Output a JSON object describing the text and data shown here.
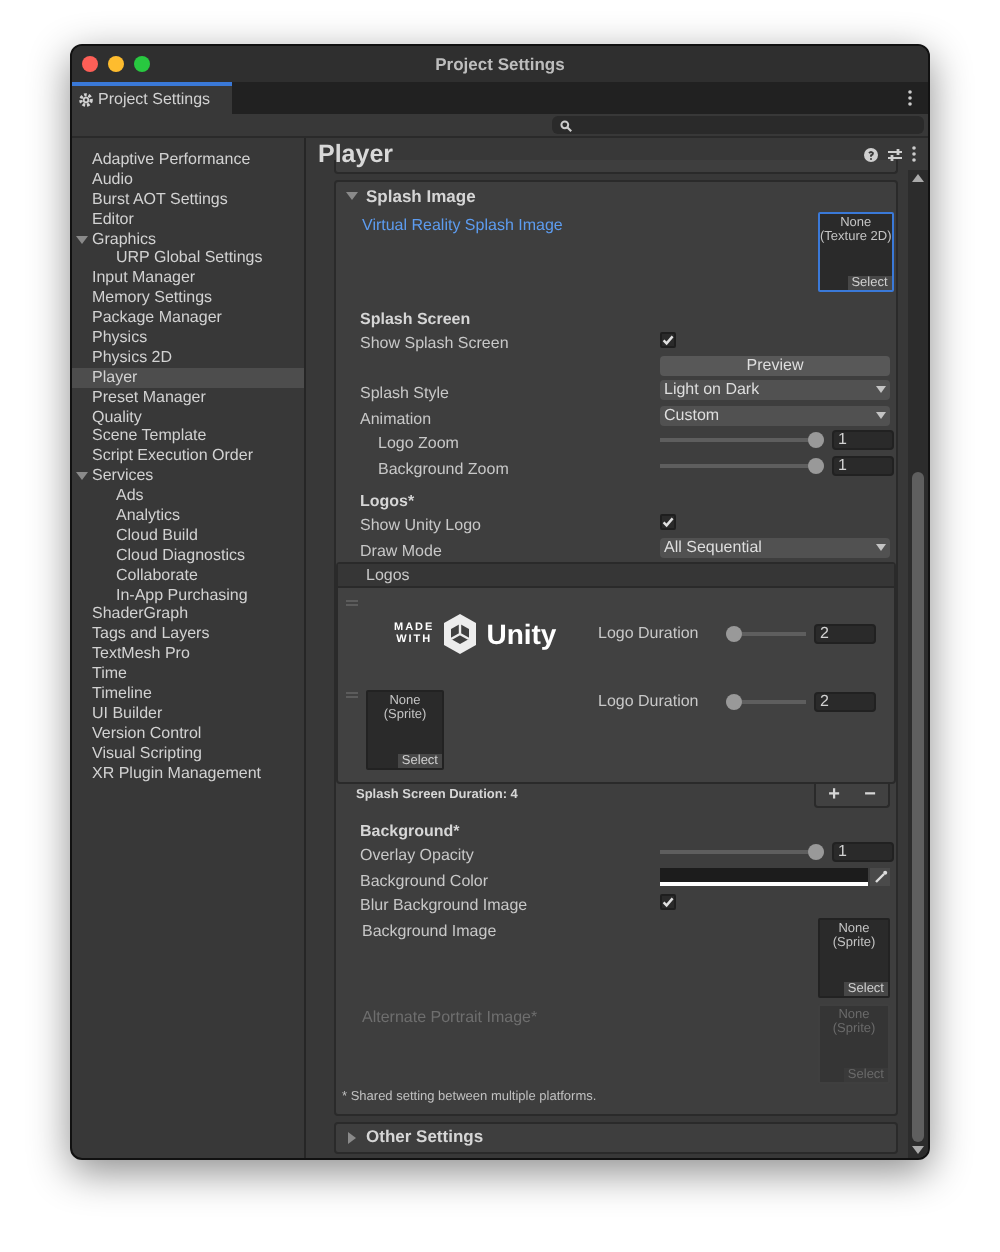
{
  "window": {
    "title": "Project Settings"
  },
  "tab": {
    "label": "Project Settings",
    "selected": true
  },
  "sidebar": {
    "items": [
      {
        "label": "Adaptive Performance",
        "selected": false
      },
      {
        "label": "Audio",
        "selected": false
      },
      {
        "label": "Burst AOT Settings",
        "selected": false
      },
      {
        "label": "Editor",
        "selected": false
      },
      {
        "label": "Graphics",
        "selected": false,
        "expanded": true,
        "children": [
          {
            "label": "URP Global Settings",
            "selected": false
          }
        ]
      },
      {
        "label": "Input Manager",
        "selected": false
      },
      {
        "label": "Memory Settings",
        "selected": false
      },
      {
        "label": "Package Manager",
        "selected": false
      },
      {
        "label": "Physics",
        "selected": false
      },
      {
        "label": "Physics 2D",
        "selected": false
      },
      {
        "label": "Player",
        "selected": true
      },
      {
        "label": "Preset Manager",
        "selected": false
      },
      {
        "label": "Quality",
        "selected": false
      },
      {
        "label": "Scene Template",
        "selected": false
      },
      {
        "label": "Script Execution Order",
        "selected": false
      },
      {
        "label": "Services",
        "selected": false,
        "expanded": true,
        "children": [
          {
            "label": "Ads",
            "selected": false
          },
          {
            "label": "Analytics",
            "selected": false
          },
          {
            "label": "Cloud Build",
            "selected": false
          },
          {
            "label": "Cloud Diagnostics",
            "selected": false
          },
          {
            "label": "Collaborate",
            "selected": false
          },
          {
            "label": "In-App Purchasing",
            "selected": false
          }
        ]
      },
      {
        "label": "ShaderGraph",
        "selected": false
      },
      {
        "label": "Tags and Layers",
        "selected": false
      },
      {
        "label": "TextMesh Pro",
        "selected": false
      },
      {
        "label": "Time",
        "selected": false
      },
      {
        "label": "Timeline",
        "selected": false
      },
      {
        "label": "UI Builder",
        "selected": false
      },
      {
        "label": "Version Control",
        "selected": false
      },
      {
        "label": "Visual Scripting",
        "selected": false
      },
      {
        "label": "XR Plugin Management",
        "selected": false
      }
    ]
  },
  "inspector": {
    "title": "Player",
    "sections": [
      {
        "title": "Splash Image",
        "expanded": true,
        "rows": [
          {
            "kind": "image",
            "label": "Virtual Reality Splash Image",
            "selected": true,
            "disabled": false,
            "value": "None",
            "type": "(Texture 2D)",
            "button": "Select"
          },
          {
            "kind": "heading",
            "label": "Splash Screen"
          },
          {
            "kind": "checkbox",
            "label": "Show Splash Screen",
            "checked": true
          },
          {
            "kind": "button",
            "label": "Preview"
          },
          {
            "kind": "dropdown",
            "label": "Splash Style",
            "value": "Light on Dark"
          },
          {
            "kind": "dropdown",
            "label": "Animation",
            "value": "Custom",
            "children": [
              {
                "kind": "slider",
                "label": "Logo Zoom",
                "level": 1,
                "value": "1"
              },
              {
                "kind": "slider",
                "label": "Background Zoom",
                "level": 1,
                "value": "1"
              }
            ]
          },
          {
            "kind": "heading",
            "label": "Logos*"
          },
          {
            "kind": "checkbox",
            "label": "Show Unity Logo",
            "checked": true
          },
          {
            "kind": "dropdown",
            "label": "Draw Mode",
            "value": "All Sequential"
          },
          {
            "kind": "logos",
            "title": "Logos",
            "entries": [
              {
                "kind": "unity",
                "made": "MADE",
                "with": "WITH",
                "brand": "Unity",
                "duration_label": "Logo Duration",
                "level": 0,
                "value": "2"
              },
              {
                "kind": "sprite",
                "slot_value": "None",
                "slot_type": "(Sprite)",
                "button": "Select",
                "duration_label": "Logo Duration",
                "level": 0,
                "value": "2"
              }
            ],
            "footer": "Splash Screen Duration: 4",
            "add": "+",
            "remove": "−"
          },
          {
            "kind": "heading",
            "label": "Background*"
          },
          {
            "kind": "slider",
            "label": "Overlay Opacity",
            "level": 1,
            "value": "1"
          },
          {
            "kind": "color",
            "label": "Background Color"
          },
          {
            "kind": "checkbox",
            "label": "Blur Background Image",
            "checked": true
          },
          {
            "kind": "image",
            "label": "Background Image",
            "selected": false,
            "disabled": false,
            "value": "None",
            "type": "(Sprite)",
            "button": "Select"
          },
          {
            "kind": "image",
            "label": "Alternate Portrait Image*",
            "selected": false,
            "disabled": true,
            "value": "None",
            "type": "(Sprite)",
            "button": "Select"
          },
          {
            "kind": "note",
            "label": "* Shared setting between multiple platforms."
          }
        ]
      },
      {
        "title": "Other Settings",
        "expanded": false
      }
    ]
  }
}
